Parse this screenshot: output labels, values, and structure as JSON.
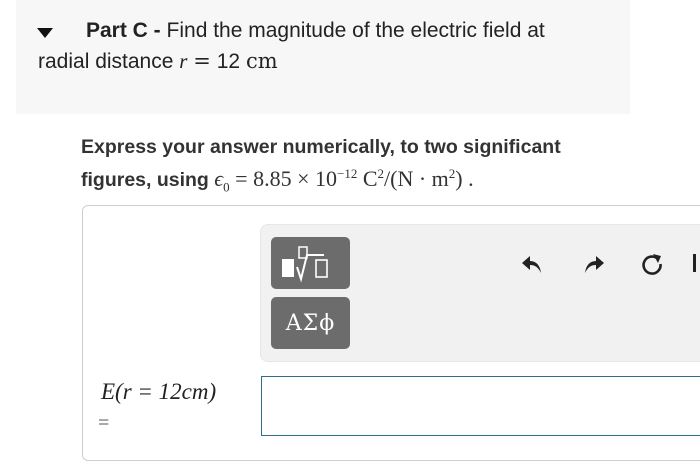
{
  "part": {
    "label": "Part C -",
    "question_start": "Find the magnitude of the electric field at",
    "question_line2_start": "radial distance",
    "variable": "r",
    "equals": "=",
    "value": "12",
    "unit": "cm"
  },
  "instructions": {
    "line1": "Express your answer numerically, to two significant",
    "line2_start": "figures, using",
    "epsilon": "ϵ",
    "epsilon_sub": "0",
    "equals": "=",
    "mantissa": "8.85 × 10",
    "exponent": "−12",
    "unit_c": "C",
    "unit_c_exp": "2",
    "unit_rest": "/(N · m",
    "unit_m_exp": "2",
    "unit_close": ") ."
  },
  "toolbar": {
    "templates_icon": "templates-icon",
    "greek_label": "ΑΣϕ",
    "undo_icon": "undo-icon",
    "redo_icon": "redo-icon",
    "reset_icon": "reset-icon"
  },
  "answer": {
    "label": "E(r = 12cm)",
    "equals": "=",
    "value": "",
    "placeholder": ""
  },
  "colors": {
    "header_bg": "#f7f7f7",
    "button_bg": "#6c6c6c",
    "input_border": "#2f6d8e"
  }
}
